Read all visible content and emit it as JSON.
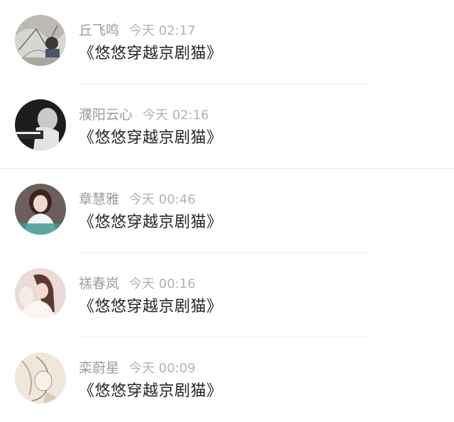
{
  "comments": [
    {
      "name": "丘飞鸣",
      "time": "今天 02:17",
      "content": "《悠悠穿越京剧猫》",
      "avatar": "sketch-art-avatar"
    },
    {
      "name": "濮阳云心",
      "time": "今天 02:16",
      "content": "《悠悠穿越京剧猫》",
      "avatar": "monochrome-portrait-avatar"
    },
    {
      "name": "章慧雅",
      "time": "今天 00:46",
      "content": "《悠悠穿越京剧猫》",
      "avatar": "girl-portrait-avatar"
    },
    {
      "name": "禚春岚",
      "time": "今天 00:16",
      "content": "《悠悠穿越京剧猫》",
      "avatar": "girl-profile-avatar"
    },
    {
      "name": "栾蔚星",
      "time": "今天 00:09",
      "content": "《悠悠穿越京剧猫》",
      "avatar": "anime-sketch-avatar"
    }
  ]
}
